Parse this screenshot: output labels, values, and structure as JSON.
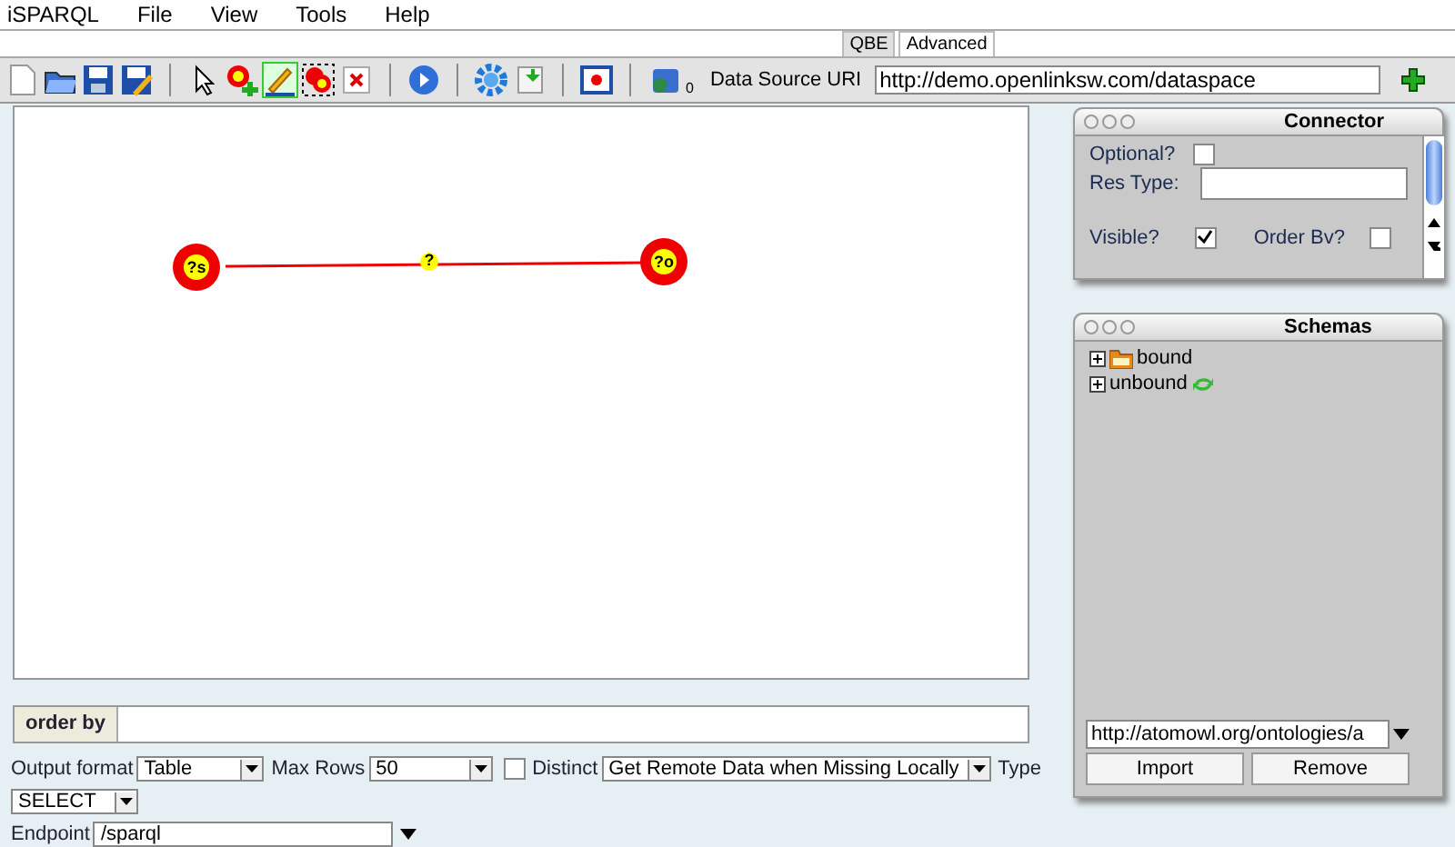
{
  "menu": [
    "iSPARQL",
    "File",
    "View",
    "Tools",
    "Help"
  ],
  "tabs": [
    {
      "label": "QBE",
      "selected": true
    },
    {
      "label": "Advanced",
      "selected": false
    }
  ],
  "toolbar": {
    "pencil_selected": true,
    "counter": "0",
    "source_label": "Data Source URI",
    "source_value": "http://demo.openlinksw.com/dataspace"
  },
  "graph": {
    "nodes": [
      {
        "label": "?s"
      },
      {
        "label": "?o"
      }
    ],
    "edge": {
      "label": "?"
    }
  },
  "connector": {
    "title": "Connector",
    "optional_label": "Optional?",
    "optional_checked": false,
    "res_type_label": "Res Type:",
    "visible_label": "Visible?",
    "visible_checked": true,
    "order_label": "Order Bv?",
    "order_checked": false
  },
  "schemas": {
    "title": "Schemas",
    "items": [
      {
        "label": "bound",
        "kind": "folder",
        "expanded": false
      },
      {
        "label": "unbound",
        "kind": "refresh",
        "expanded": false
      }
    ],
    "url": "http://atomowl.org/ontologies/a",
    "buttons": [
      "Import",
      "Remove"
    ]
  },
  "order_by": {
    "label": "order by"
  },
  "options": {
    "output_label": "Output format",
    "output_value": "Table",
    "max_label": "Max Rows",
    "max_value": "50",
    "distinct_label": "Distinct",
    "distinct_checked": false,
    "remote_value": "Get Remote Data when Missing Locally",
    "type_label": "Type",
    "type_value": "SELECT",
    "endpoint_label": "Endpoint",
    "endpoint_value": "/sparql"
  }
}
